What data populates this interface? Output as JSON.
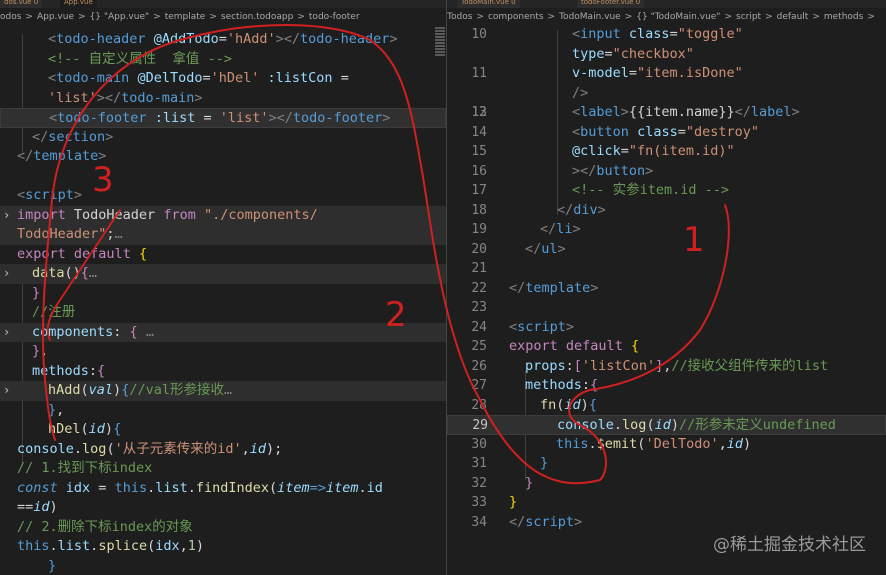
{
  "left": {
    "tabs": [
      "dos.vue 0",
      "App.vue"
    ],
    "breadcrumb": [
      "odos",
      ">",
      "App.vue",
      ">",
      "{} \"App.vue\"",
      ">",
      "template",
      ">",
      "section.todoapp",
      ">",
      "todo-footer"
    ]
  },
  "right": {
    "tabs": [
      "TodoMain.vue 0",
      "todoFooter.vue 0"
    ],
    "breadcrumb": [
      "Todos",
      ">",
      "components",
      ">",
      "TodoMain.vue",
      ">",
      "{} \"TodoMain.vue\"",
      ">",
      "script",
      ">",
      "default",
      ">",
      "methods",
      ">"
    ]
  },
  "annotations": {
    "n1": "1",
    "n2": "2",
    "n3": "3"
  },
  "watermark": "@稀土掘金技术社区",
  "colors": {
    "editor_bg": "#1e1e1e",
    "ink": "#d02020",
    "tag": "#569cd6",
    "string": "#ce9178",
    "comment": "#6a9955",
    "keyword": "#c586c0"
  },
  "icons": [
    "fold-chevron-icon",
    "cube-icon"
  ]
}
